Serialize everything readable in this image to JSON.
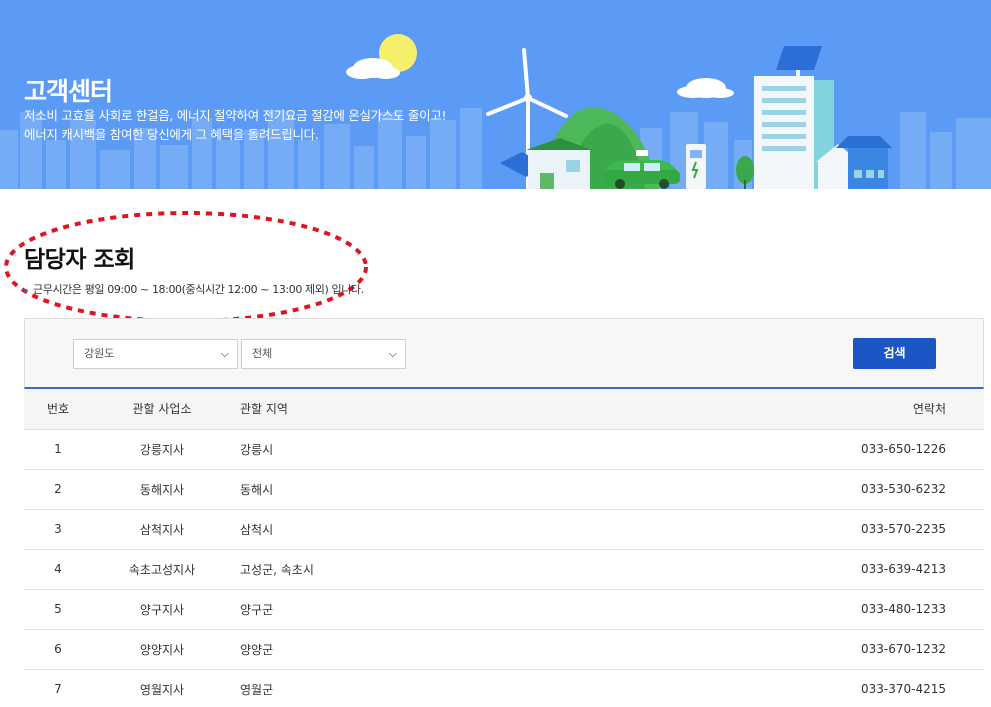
{
  "banner": {
    "title": "고객센터",
    "desc_line1": "저소비 고효율 사회로 한걸음, 에너지 절약하여 전기요금 절감에 온실가스도 줄이고!",
    "desc_line2": "에너지 캐시백을 참여한 당신에게 그 혜택을 돌려드립니다."
  },
  "page": {
    "title": "담당자 조회",
    "work_hours": "근무시간은 평일 09:00 ~ 18:00(중식시간 12:00 ~ 13:00 제외) 입니다."
  },
  "search": {
    "region_value": "강원도",
    "area_value": "전체",
    "button_label": "검색"
  },
  "table": {
    "headers": {
      "no": "번호",
      "office": "관할 사업소",
      "area": "관할 지역",
      "phone": "연락처"
    },
    "rows": [
      {
        "no": "1",
        "office": "강릉지사",
        "area": "강릉시",
        "phone": "033-650-1226"
      },
      {
        "no": "2",
        "office": "동해지사",
        "area": "동해시",
        "phone": "033-530-6232"
      },
      {
        "no": "3",
        "office": "삼척지사",
        "area": "삼척시",
        "phone": "033-570-2235"
      },
      {
        "no": "4",
        "office": "속초고성지사",
        "area": "고성군, 속초시",
        "phone": "033-639-4213"
      },
      {
        "no": "5",
        "office": "양구지사",
        "area": "양구군",
        "phone": "033-480-1233"
      },
      {
        "no": "6",
        "office": "양양지사",
        "area": "양양군",
        "phone": "033-670-1232"
      },
      {
        "no": "7",
        "office": "영월지사",
        "area": "영월군",
        "phone": "033-370-4215"
      }
    ]
  },
  "colors": {
    "banner_bg": "#5b9bf5",
    "primary_button": "#1a56c4",
    "annotation": "#e0141e"
  }
}
